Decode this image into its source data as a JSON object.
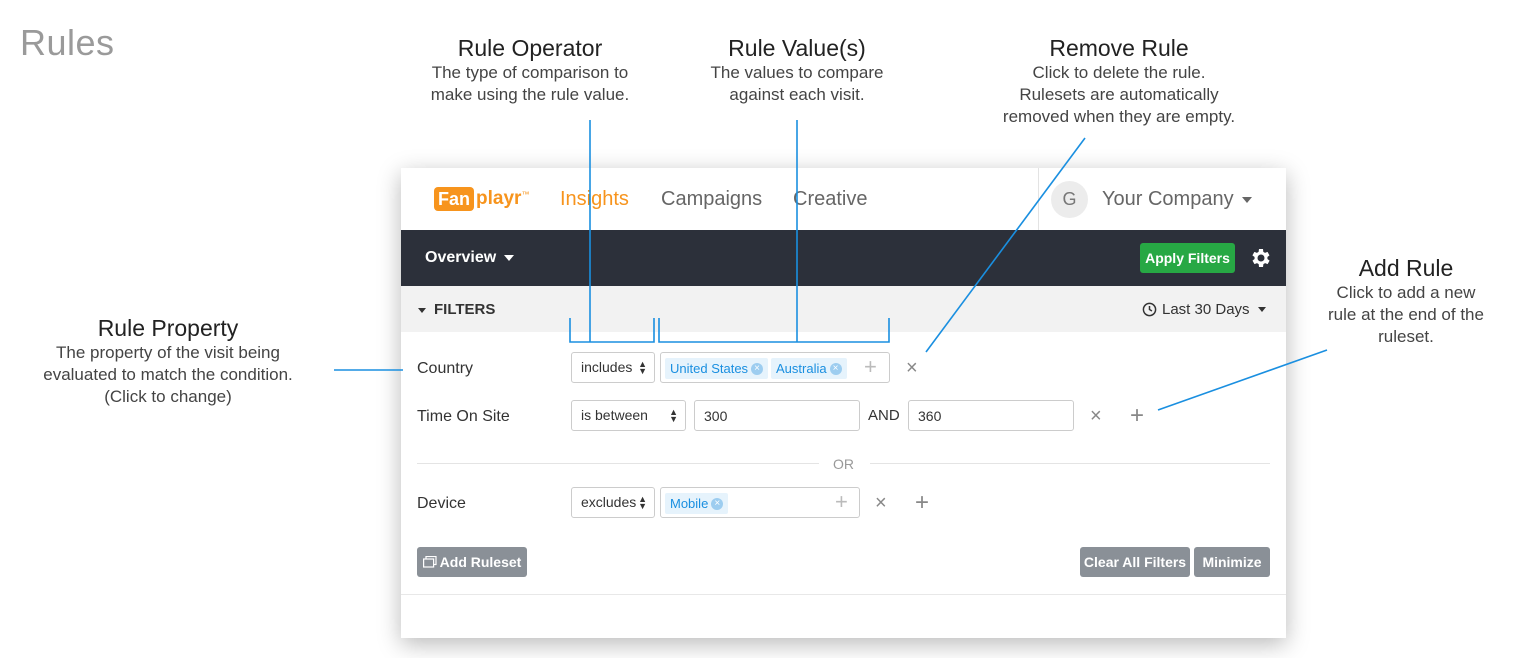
{
  "page_title": "Rules",
  "annotations": {
    "rule_operator": {
      "title": "Rule Operator",
      "desc1": "The type of comparison to",
      "desc2": "make using the rule value."
    },
    "rule_values": {
      "title": "Rule Value(s)",
      "desc1": "The values to compare",
      "desc2": "against each visit."
    },
    "remove_rule": {
      "title": "Remove Rule",
      "desc1": "Click to delete the rule.",
      "desc2": "Rulesets are automatically",
      "desc3": "removed when they are empty."
    },
    "add_rule": {
      "title": "Add Rule",
      "desc1": "Click to add a new",
      "desc2": "rule at the end of the",
      "desc3": "ruleset."
    },
    "rule_property": {
      "title": "Rule Property",
      "desc1": "The property of the visit being",
      "desc2": "evaluated to match the condition.",
      "desc3": "(Click to change)"
    }
  },
  "app": {
    "logo": {
      "fan": "Fan",
      "playr": "playr",
      "tm": "™"
    },
    "nav": {
      "insights": "Insights",
      "campaigns": "Campaigns",
      "creative": "Creative"
    },
    "account": {
      "avatar": "G",
      "company": "Your Company"
    },
    "toolbar": {
      "overview": "Overview",
      "apply": "Apply Filters"
    },
    "filters": {
      "label": "FILTERS",
      "range": "Last 30 Days"
    },
    "rules": {
      "country": {
        "label": "Country",
        "operator": "includes",
        "tags": [
          "United States",
          "Australia"
        ]
      },
      "time_on_site": {
        "label": "Time On Site",
        "operator": "is between",
        "from": "300",
        "and": "AND",
        "to": "360"
      },
      "or": "OR",
      "device": {
        "label": "Device",
        "operator": "excludes",
        "tags": [
          "Mobile"
        ]
      }
    },
    "buttons": {
      "add_ruleset": "Add Ruleset",
      "clear_all": "Clear All Filters",
      "minimize": "Minimize"
    },
    "icons": {
      "remove": "×",
      "add": "+",
      "tag_remove": "×",
      "select_arrows": "▲▼"
    }
  }
}
